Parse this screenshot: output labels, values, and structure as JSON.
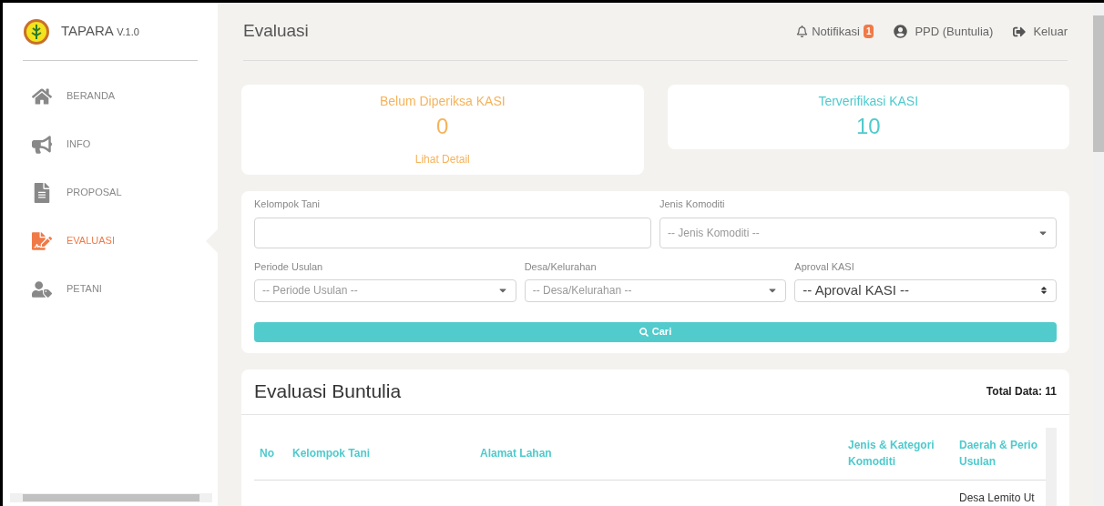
{
  "brand": {
    "name": "TAPARA",
    "version": "V.1.0"
  },
  "sidebar": {
    "items": [
      {
        "label": "BERANDA",
        "kind": "home",
        "selected": false
      },
      {
        "label": "INFO",
        "kind": "megaphone",
        "selected": false
      },
      {
        "label": "PROPOSAL",
        "kind": "document",
        "selected": false
      },
      {
        "label": "EVALUASI",
        "kind": "edit",
        "selected": true
      },
      {
        "label": "PETANI",
        "kind": "user",
        "selected": false
      }
    ]
  },
  "header": {
    "title": "Evaluasi",
    "notification": {
      "label": "Notifikasi",
      "count": "1"
    },
    "user": "PPD (Buntulia)",
    "logout": "Keluar"
  },
  "stats": [
    {
      "title": "Belum Diperiksa KASI",
      "value": "0",
      "link": "Lihat Detail",
      "kind": "warning"
    },
    {
      "title": "Terverifikasi KASI",
      "value": "10",
      "kind": "info"
    }
  ],
  "filters": {
    "kelompok_tani": {
      "label": "Kelompok Tani"
    },
    "jenis_komoditi": {
      "label": "Jenis Komoditi",
      "placeholder": "-- Jenis Komoditi --"
    },
    "periode_usulan": {
      "label": "Periode Usulan",
      "placeholder": "-- Periode Usulan --"
    },
    "desa": {
      "label": "Desa/Kelurahan",
      "placeholder": "-- Desa/Kelurahan --"
    },
    "aproval": {
      "label": "Aproval KASI",
      "placeholder": "-- Aproval KASI --"
    },
    "search_button": "Cari"
  },
  "table": {
    "title": "Evaluasi Buntulia",
    "total": "Total Data: 11",
    "columns": [
      "No",
      "Kelompok Tani",
      "Alamat Lahan",
      "Jenis & Kategori Komoditi",
      "Daerah & Perio Usulan"
    ],
    "rows": [
      [
        "",
        "",
        "",
        "",
        "Desa Lemito Ut"
      ]
    ]
  }
}
